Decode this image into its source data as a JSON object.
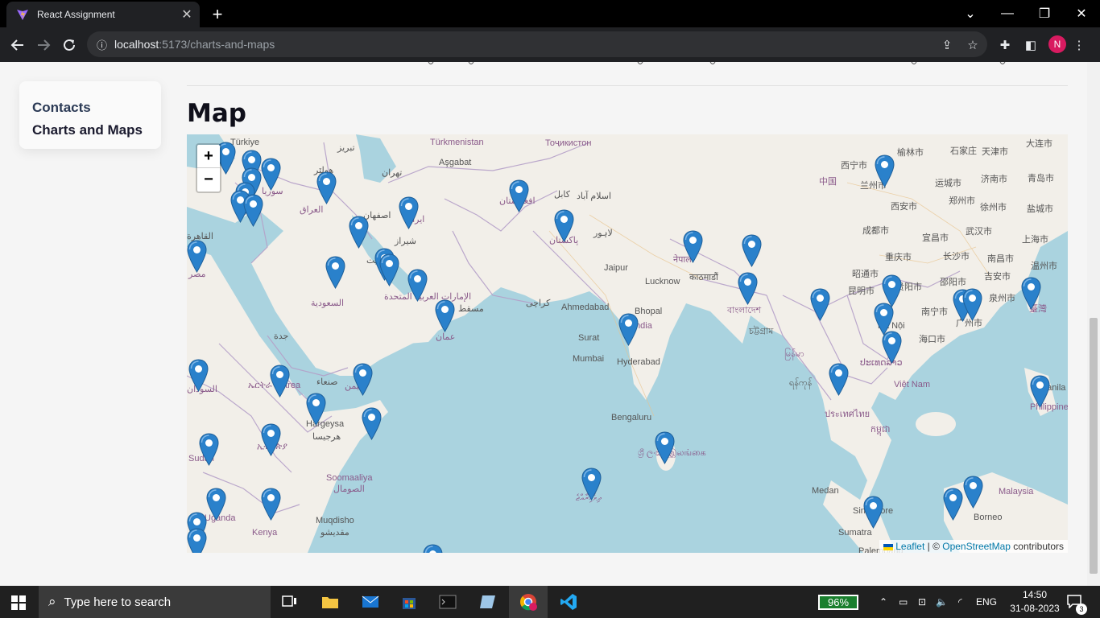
{
  "browser": {
    "tab_title": "React Assignment",
    "url_host": "localhost",
    "url_path": ":5173/charts-and-maps",
    "avatar_letter": "N"
  },
  "sidebar": {
    "items": [
      {
        "label": "Contacts"
      },
      {
        "label": "Charts and Maps"
      }
    ]
  },
  "main": {
    "heading": "Map"
  },
  "map": {
    "zoom_in": "+",
    "zoom_out": "−",
    "attribution": {
      "leaflet": "Leaflet",
      "separator": " | © ",
      "osm": "OpenStreetMap",
      "suffix": " contributors"
    },
    "labels": [
      "Türkiye",
      "Türkmenistan",
      "Aşgabat",
      "Тоҷикистон",
      "تبریز",
      "هولێر",
      "تهران",
      "سوريا",
      "العراق",
      "اصفهان",
      "ایران",
      "القاهرة",
      "مصر",
      "الكويت",
      "شيراز",
      "السعودية",
      "الإمارات العربية المتحدة",
      "مسقط",
      "عمان",
      "افغانستان",
      "کابل",
      "اسلام آباد",
      "لاہور",
      "پاکستان",
      "کراچی",
      "Jaipur",
      "Lucknow",
      "Ahmedabad",
      "Bhopal",
      "India",
      "Surat",
      "Mumbai",
      "Hyderabad",
      "Bengaluru",
      "ශ්‍රී ලංකා இலங்கை",
      "ދިވެހިރާއްޖެ",
      "नेपाल",
      "काठमाडौं",
      "বাংলাদেশ",
      "চট্টগ্রাম",
      "မြန်မာ",
      "ရန်ကုန်",
      "ประเทศไทย",
      "Việt Nam",
      "Hà Nội",
      "ປະເທດລາວ",
      "កម្ពុជា",
      "中国",
      "西宁市",
      "兰州市",
      "榆林市",
      "石家庄",
      "天津市",
      "运城市",
      "济南市",
      "青岛市",
      "西安市",
      "郑州市",
      "徐州市",
      "盐城市",
      "成都市",
      "宜昌市",
      "武汉市",
      "上海市",
      "重庆市",
      "长沙市",
      "南昌市",
      "温州市",
      "昭通市",
      "贵阳市",
      "邵阳市",
      "吉安市",
      "昆明市",
      "南宁市",
      "广州市",
      "泉州市",
      "臺灣",
      "海口市",
      "大连市",
      "Philippines",
      "Manila",
      "Malaysia",
      "Borneo",
      "Singapore",
      "Medan",
      "Sumatra",
      "Palembang",
      "جدة",
      "صنعاء",
      "اليمن",
      "ኤርትራ Eritrea",
      "Hargeysa",
      "هرجيسا",
      "Soomaaliya",
      "الصومال",
      "Muqdisho",
      "مقديشو",
      "السودان",
      "Sudan",
      "ኢትዮጵያ",
      "Uganda",
      "Kenya"
    ],
    "marker_count": 44
  },
  "taskbar": {
    "search_placeholder": "Type here to search",
    "battery": "96%",
    "language": "ENG",
    "time": "14:50",
    "date": "31-08-2023",
    "notifications": "3"
  },
  "colors": {
    "water": "#aad3df",
    "land": "#f2efe9",
    "border": "#b5a0c8",
    "marker": "#2a81cb"
  }
}
